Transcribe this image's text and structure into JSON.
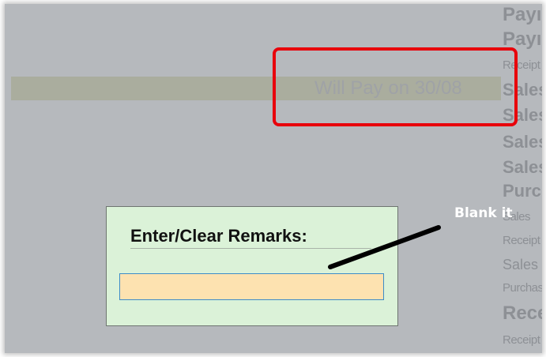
{
  "background_list": [
    "Payı",
    "Payı",
    "Receipt",
    "Sales",
    "Sales",
    "Sales",
    "Sales",
    "Purc",
    "Sales",
    "Receipt",
    "Sales",
    "Purchas",
    "Rece",
    "Receipt"
  ],
  "highlighted_remark": "Will Pay on 30/08",
  "dialog": {
    "title": "Enter/Clear Remarks:",
    "input_value": ""
  },
  "callout": {
    "label": "Blank it"
  },
  "colors": {
    "annotation_red": "#e8000b",
    "dialog_bg": "#dbf2d8",
    "input_bg": "#fde2b0",
    "input_border": "#3d8cc8",
    "highlight_row": "#aaad9e"
  }
}
